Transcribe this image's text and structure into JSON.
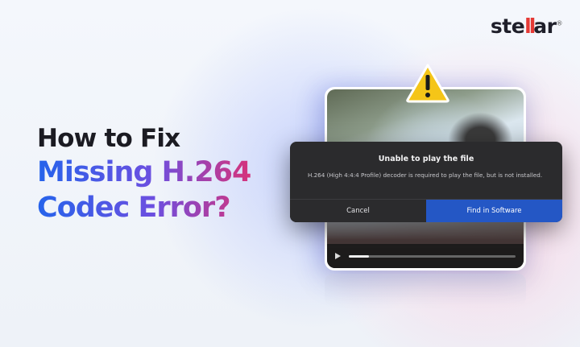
{
  "brand": {
    "logo_prefix": "ste",
    "logo_bars": "ll",
    "logo_suffix": "ar",
    "logo_mark": "®"
  },
  "headline": {
    "line1": "How to Fix",
    "line2": "Missing H.264",
    "line3": "Codec Error?"
  },
  "dialog": {
    "title": "Unable to play the file",
    "message": "H.264 (High 4:4:4 Profile) decoder is required to play the file, but is not installed.",
    "cancel_label": "Cancel",
    "find_label": "Find in Software"
  },
  "player": {
    "progress": 0.12
  },
  "icons": {
    "warning": "warning-triangle-icon",
    "play": "play-icon"
  },
  "colors": {
    "accent_blue": "#2457c5",
    "gradient_start": "#2563eb",
    "gradient_end": "#d6337b",
    "warning_yellow": "#f5c518",
    "logo_red": "#e53935"
  }
}
